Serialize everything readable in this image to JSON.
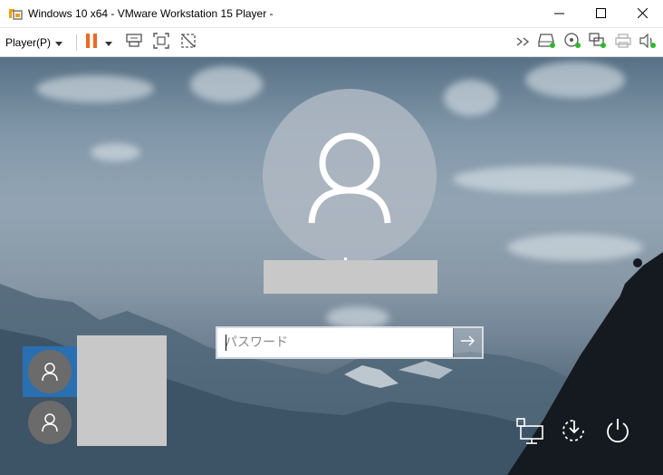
{
  "window": {
    "title": "Windows 10 x64 - VMware Workstation 15 Player -",
    "minimize_icon": "minimize-icon",
    "maximize_icon": "maximize-icon",
    "close_icon": "close-icon"
  },
  "toolbar": {
    "player_label": "Player(P)",
    "left_icons": [
      "pause-icon",
      "dropdown-arrow-icon",
      "send-ctrl-alt-del-icon",
      "fullscreen-icon",
      "unity-icon"
    ],
    "right_icons": [
      "more-devices-icon",
      "hard-disk-icon",
      "cd-drive-icon",
      "network-adapter-icon",
      "printer-icon",
      "sound-icon"
    ]
  },
  "lock_screen": {
    "password_placeholder": "パスワード",
    "submit_icon": "arrow-right-icon",
    "users": [
      "user-tile-1",
      "user-tile-2"
    ],
    "corner_icons": [
      "network-icon",
      "ease-of-access-icon",
      "power-icon"
    ]
  },
  "colors": {
    "pause_orange": "#f26722",
    "selected_user": "#2a6fb0",
    "device_green": "#2db82d"
  }
}
